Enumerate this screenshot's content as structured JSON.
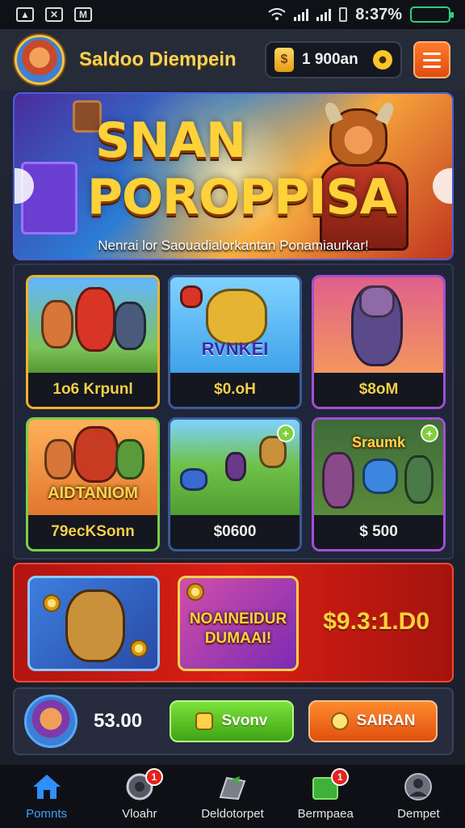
{
  "status_bar": {
    "time": "8:37%"
  },
  "header": {
    "title": "Saldoo Diempein",
    "currency_value": "1 900an",
    "coin_symbol": "$"
  },
  "banner": {
    "title_line1": "SNAN",
    "title_line2": "POROPPISA",
    "tagline": "Nenrai lor Saouadialorkantan Ponamiaurkar!"
  },
  "cards": [
    {
      "price": "1o6 Krpunl",
      "art_label": ""
    },
    {
      "price": "$0.oH",
      "art_label": "RVNKEI"
    },
    {
      "price": "$8oM",
      "art_label": ""
    },
    {
      "price": "79ecKSonn",
      "art_label": "AIDTANIOM"
    },
    {
      "price": "$0600",
      "art_label": ""
    },
    {
      "price": "$ 500",
      "art_label": "Sraumk"
    }
  ],
  "promo": {
    "card_text_line1": "NOAINEIDUR",
    "card_text_line2": "DUMAAI!",
    "price": "$9.3:1.D0"
  },
  "action_bar": {
    "value": "53.00",
    "green_button": "Svonv",
    "orange_button": "SAIRAN"
  },
  "nav": [
    {
      "label": "Pomnts",
      "icon": "home-icon",
      "badge": ""
    },
    {
      "label": "Vloahr",
      "icon": "wheel-icon",
      "badge": "1"
    },
    {
      "label": "Deldotorpet",
      "icon": "gift-icon",
      "badge": ""
    },
    {
      "label": "Bermpaea",
      "icon": "flag-icon",
      "badge": "1"
    },
    {
      "label": "Dempet",
      "icon": "profile-icon",
      "badge": ""
    }
  ],
  "colors": {
    "accent": "#ffd23a",
    "active_nav": "#3aa3ff",
    "promo_red": "#d92016",
    "green": "#4fba1e",
    "orange": "#f06a1c"
  }
}
